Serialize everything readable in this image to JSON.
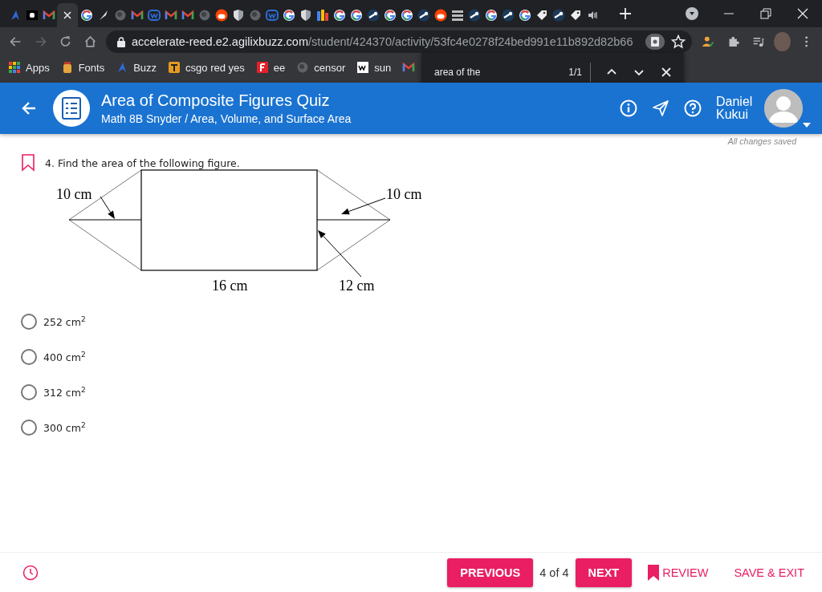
{
  "browser": {
    "tabs": [
      {
        "kind": "arrow-logo",
        "selected": false
      },
      {
        "kind": "bold",
        "selected": false
      },
      {
        "kind": "mail",
        "selected": false
      },
      {
        "kind": "close",
        "selected": true
      },
      {
        "kind": "google",
        "selected": false
      },
      {
        "kind": "feather",
        "selected": false
      },
      {
        "kind": "globe",
        "selected": false
      },
      {
        "kind": "mail",
        "selected": false
      },
      {
        "kind": "w-logo",
        "selected": false
      },
      {
        "kind": "mail",
        "selected": false
      },
      {
        "kind": "mail",
        "selected": false
      },
      {
        "kind": "globe",
        "selected": false
      },
      {
        "kind": "reddit",
        "selected": false
      },
      {
        "kind": "shield",
        "selected": false
      },
      {
        "kind": "globe",
        "selected": false
      },
      {
        "kind": "w-logo",
        "selected": false
      },
      {
        "kind": "google",
        "selected": false
      },
      {
        "kind": "shield",
        "selected": false
      },
      {
        "kind": "chart",
        "selected": false
      },
      {
        "kind": "google",
        "selected": false
      },
      {
        "kind": "google",
        "selected": false
      },
      {
        "kind": "steam",
        "selected": false
      },
      {
        "kind": "google",
        "selected": false
      },
      {
        "kind": "google",
        "selected": false
      },
      {
        "kind": "steam",
        "selected": false
      },
      {
        "kind": "reddit",
        "selected": false
      },
      {
        "kind": "bars",
        "selected": false
      },
      {
        "kind": "steam",
        "selected": false
      },
      {
        "kind": "google",
        "selected": false
      },
      {
        "kind": "steam",
        "selected": false
      },
      {
        "kind": "google",
        "selected": false
      },
      {
        "kind": "tag",
        "selected": false
      },
      {
        "kind": "steam",
        "selected": false
      },
      {
        "kind": "tag",
        "selected": false
      },
      {
        "kind": "audio",
        "selected": false
      }
    ],
    "forward_disabled": true,
    "address_bar": {
      "host": "accelerate-reed.e2.agilixbuzz.com",
      "path": "/student/424370/activity/53fc4e0278f24bed991e11b892d82b66"
    },
    "bookmarks": [
      {
        "kind": "apps",
        "label": "Apps"
      },
      {
        "kind": "jar",
        "label": "Fonts"
      },
      {
        "kind": "arrow-logo",
        "label": "Buzz"
      },
      {
        "kind": "orange-square",
        "label": "csgo red yes"
      },
      {
        "kind": "red-square",
        "label": "ee"
      },
      {
        "kind": "globe",
        "label": "censor"
      },
      {
        "kind": "white-square",
        "label": "sun"
      },
      {
        "kind": "mail"
      }
    ],
    "find_bar": {
      "query": "area of the",
      "count": "1/1"
    }
  },
  "header": {
    "title": "Area of Composite Figures Quiz",
    "subtitle": "Math 8B Snyder / Area, Volume, and Surface Area",
    "user_name": "Daniel Kukui"
  },
  "save_status": "All changes saved",
  "question": {
    "bookmarked": false,
    "text": "4. Find the area of the following figure.",
    "figure": {
      "labels": [
        "10 cm",
        "10 cm",
        "16 cm",
        "12 cm"
      ]
    },
    "choices": [
      {
        "label": "252 cm$^{2}$",
        "selected": false
      },
      {
        "label": "400 cm$^{2}$",
        "selected": false
      },
      {
        "label": "312 cm$^{2}$",
        "selected": false
      },
      {
        "label": "300 cm$^{2}$",
        "selected": false
      }
    ]
  },
  "footer": {
    "previous": "PREVIOUS",
    "position": "4 of 4",
    "next": "NEXT",
    "review": "REVIEW",
    "save_exit": "SAVE & EXIT"
  }
}
